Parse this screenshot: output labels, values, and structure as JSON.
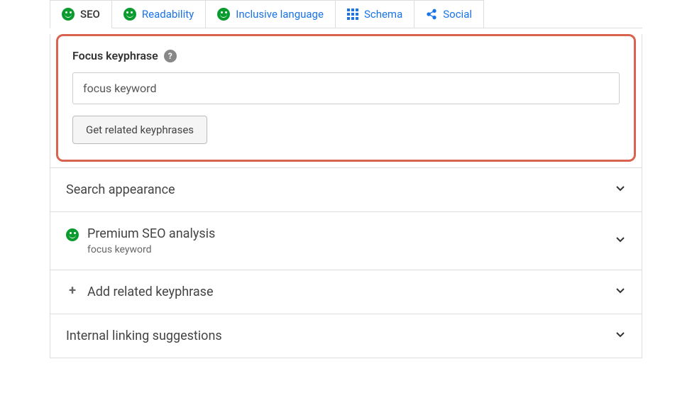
{
  "tabs": {
    "seo": "SEO",
    "readability": "Readability",
    "inclusive": "Inclusive language",
    "schema": "Schema",
    "social": "Social"
  },
  "keyphrase": {
    "label": "Focus keyphrase",
    "value": "focus keyword",
    "button": "Get related keyphrases"
  },
  "accordions": {
    "search_appearance": "Search appearance",
    "premium_title": "Premium SEO analysis",
    "premium_sub": "focus keyword",
    "add_related": "Add related keyphrase",
    "internal_linking": "Internal linking suggestions"
  }
}
